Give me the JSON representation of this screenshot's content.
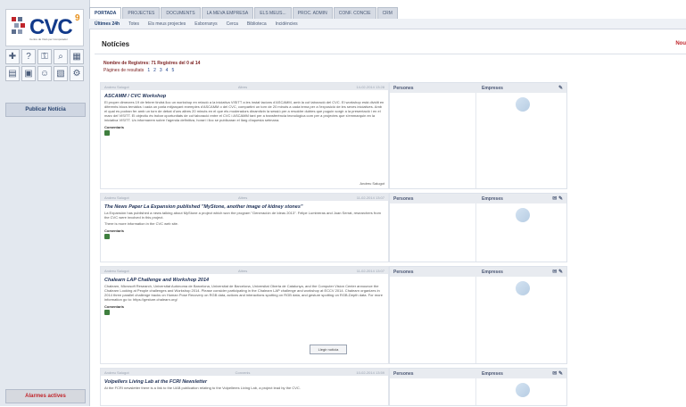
{
  "sidebar": {
    "logo_text": "CVC",
    "logo_sup": "9",
    "logo_sub": "Centre de Visió per Computador",
    "icons": [
      "user-plus-icon",
      "question-icon",
      "lock-icon",
      "search-icon",
      "calendar-icon",
      "grid-icon",
      "box-icon",
      "people-icon",
      "image-icon",
      "settings-icon"
    ],
    "publish_label": "Publicar Notícia",
    "alerts_label": "Alarmes actives"
  },
  "topnav": {
    "tabs": [
      "PORTADA",
      "PROJECTES",
      "DOCUMENTS",
      "LA MEVA EMPRESA",
      "ELS MEUS...",
      "PROC. ADMIN",
      "CONF. CONCIE",
      "CRM"
    ],
    "active": 0
  },
  "subnav": {
    "tabs": [
      "Últimes 24h",
      "Totes",
      "Els meus projectes",
      "Esborranys",
      "Cerca",
      "Biblioteca",
      "Incidències"
    ],
    "active": 0
  },
  "page": {
    "title": "Notícies",
    "new_link": "Nou",
    "records": "Nombre de Registres: 71   Registres del 0 al 14",
    "pages_label": "Pàgines de resultats",
    "pages": [
      "1",
      "2",
      "3",
      "4",
      "5"
    ]
  },
  "news": [
    {
      "author": "Andreu Salugot",
      "category": "Altres",
      "date": "14-02-2014 13:28",
      "title": "ASCAMM / CVC Workshop",
      "body": "El proper dimecres 19 de febrer tindrà lloc un workshop en relació a la iniciativa VISITT a les instal·lacions d'ASCAMM, amb la col·laboració del CVC. El workshop està dividit en diferents blocs temàtics i cada un parla mitjançant exemples d'ASCAMM o del CVC, compartint un torn de 20 minuts a cada tema per a l'exposició de les seves iniciatives. Amb el qual es podran fer amb un torn de debat d'uns altres 20 minuts en el que els moderadors dinamitzin la sessió per a resoldre dubtes que puguin sorgir a la presentació i en el marc del VISITT. El objectiu és trobar oportunitats de col·laboració entre el CVC i ASCAMM tant per a transferència tecnològica com per a projectes que s'emmarquin en la iniciativa VISITT. Us informarem sobre l'agenda definitiva, horari i lloc se publicaran el llarg d'aquesta setmana.",
      "more": "",
      "comment_label": "Comentaris",
      "signature": "Andreu Salugot"
    },
    {
      "author": "Andreu Salugot",
      "category": "Altres",
      "date": "11-02-2014 13:07",
      "title": "The News Paper La Expansion published \"MyStone, another image of kidney stones\"",
      "body": "La Expansión has published a news talking about MyStone a project which won the program \"Generación de Ideas 2013\". Felipe Lumbreras and Joan Serrat, researchers from the CVC were involved in this project.",
      "more": "There is more information in the CVC web site.",
      "comment_label": "Comentaris",
      "signature": ""
    },
    {
      "author": "Andreu Salugot",
      "category": "Altres",
      "date": "11-02-2014 13:07",
      "title": "Chalearn LAP Challenge and Workshop 2014",
      "body": "Chalearn, Microsoft Research, Universitat Autònoma de Barcelona, Universitat de Barcelona, Universitat Oberta de Catalunya, and the Computer Vision Center announce the Chalearn Looking at People challenges and Workshop 2014. Please consider participating in the Chalearn LAP challenge and workshop at ECCV 2014. Chalearn organizes in 2014 three parallel challenge tracks on Human Pose Recovery on RGB data, actions and interactions spotting on RGB data, and gesture spotting on RGB-Depth data. For more information go to: https://gesture.chalearn.org/",
      "more": "",
      "comment_label": "Comentaris",
      "read_btn": "Llegir notícia",
      "signature": ""
    },
    {
      "author": "Andreu Salugot",
      "category": "Convenis",
      "date": "10-02-2014 13:59",
      "title": "Volpellers Living Lab at the FCRI Newsletter",
      "body": "At the FCRI newsletter there is a link to the UAB publication relating to the Volpelleres Living Lab, a project lead by the CVC.",
      "more": "",
      "comment_label": "",
      "signature": ""
    }
  ],
  "side": {
    "persons": "Persones",
    "companies": "Empreses",
    "tools": [
      "✎",
      "✉ ✎",
      "✉ ✎",
      "✉ ✎"
    ]
  }
}
